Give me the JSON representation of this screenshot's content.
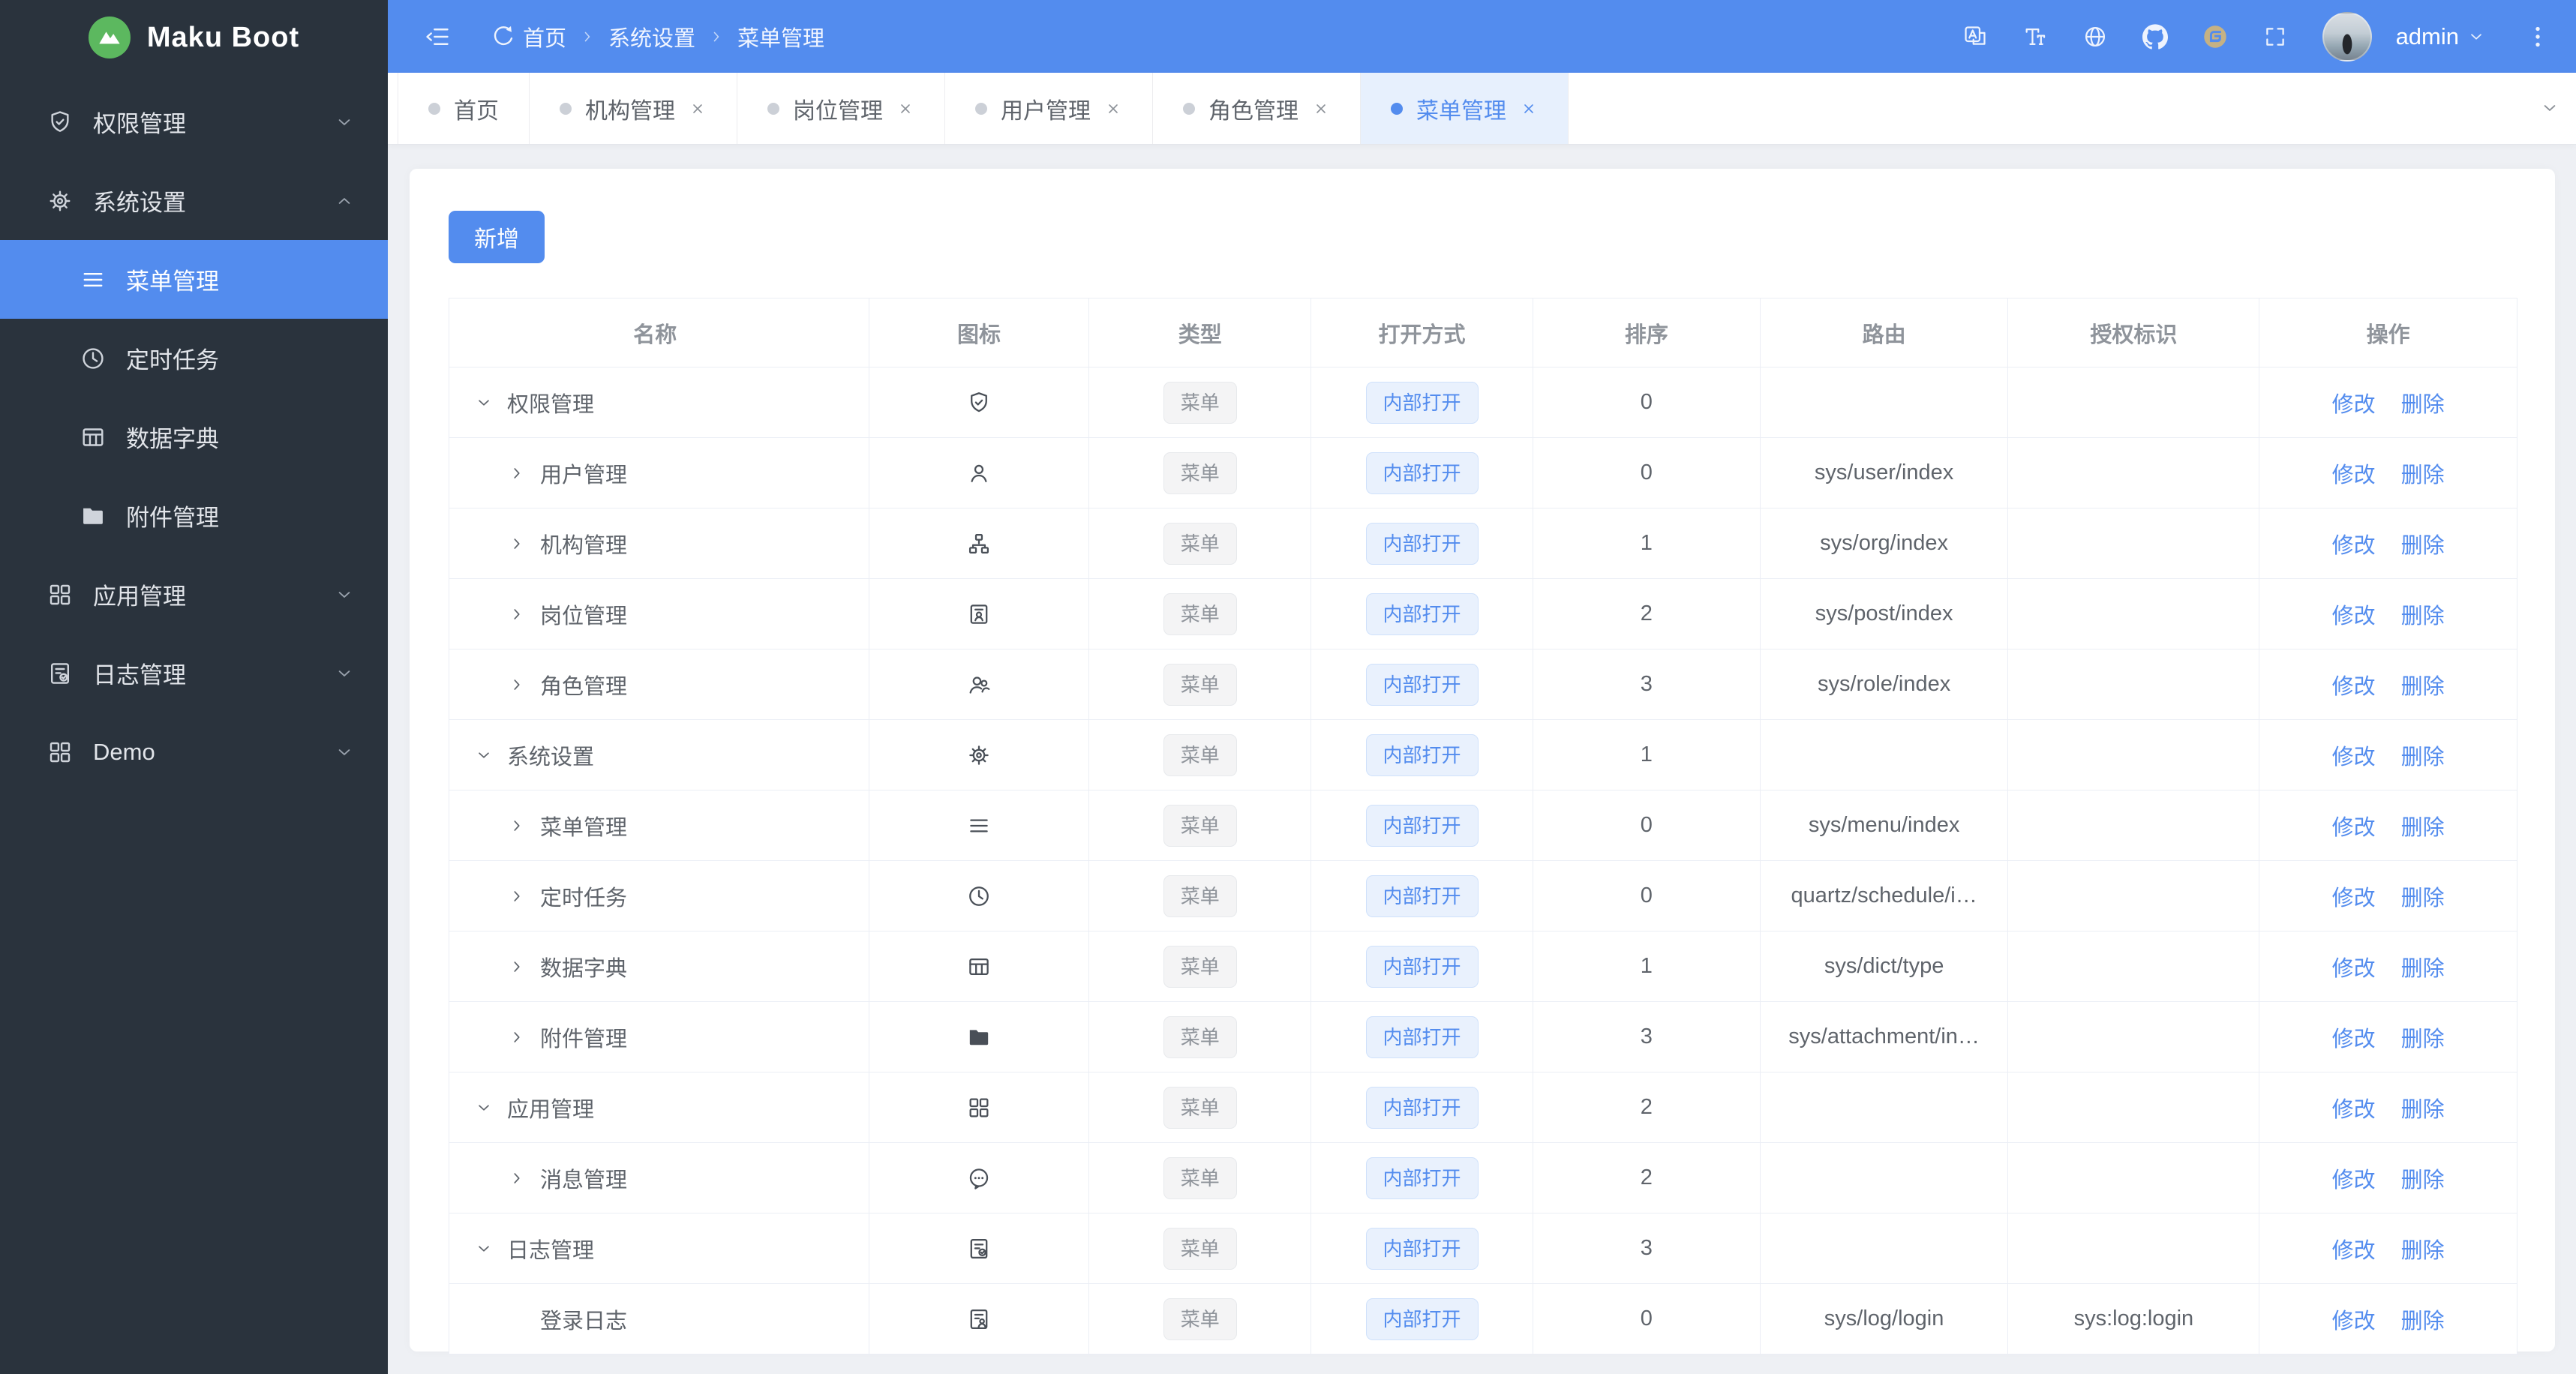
{
  "brand": {
    "name": "Maku Boot",
    "logo_icon": "mountain-logo-icon",
    "logo_color": "#5cb85f"
  },
  "colors": {
    "primary": "#538cee",
    "sidebar_bg": "#2a333d",
    "content_bg": "#eef0f4",
    "tag_gray_bg": "#f4f4f5",
    "tag_gray_text": "#8f949b",
    "tag_blue_bg": "#e9f1fd",
    "tag_blue_text": "#538cee",
    "gitee_gold": "#b9a77d",
    "table_border": "#ebeef5"
  },
  "sidebar": {
    "items": [
      {
        "label": "权限管理",
        "icon": "shield-icon",
        "caret": "down"
      },
      {
        "label": "系统设置",
        "icon": "gear-icon",
        "caret": "up",
        "children": [
          {
            "label": "菜单管理",
            "icon": "menu-icon",
            "active": true
          },
          {
            "label": "定时任务",
            "icon": "clock-icon"
          },
          {
            "label": "数据字典",
            "icon": "dict-icon"
          },
          {
            "label": "附件管理",
            "icon": "folder-icon"
          }
        ]
      },
      {
        "label": "应用管理",
        "icon": "apps-icon",
        "caret": "down"
      },
      {
        "label": "日志管理",
        "icon": "log-icon",
        "caret": "down"
      },
      {
        "label": "Demo",
        "icon": "apps-icon",
        "caret": "down"
      }
    ]
  },
  "topbar": {
    "left_icons": [
      "fold-icon",
      "refresh-icon"
    ],
    "breadcrumb": [
      "首页",
      "系统设置",
      "菜单管理"
    ],
    "right_icons": [
      "translate-icon",
      "font-size-icon",
      "globe-icon",
      "github-icon",
      "gitee-icon",
      "fullscreen-icon"
    ],
    "username": "admin",
    "more_icon": "more-icon"
  },
  "tabs": [
    {
      "label": "首页",
      "closable": false,
      "active": false
    },
    {
      "label": "机构管理",
      "closable": true,
      "active": false
    },
    {
      "label": "岗位管理",
      "closable": true,
      "active": false
    },
    {
      "label": "用户管理",
      "closable": true,
      "active": false
    },
    {
      "label": "角色管理",
      "closable": true,
      "active": false
    },
    {
      "label": "菜单管理",
      "closable": true,
      "active": true
    }
  ],
  "toolbar": {
    "add_label": "新增"
  },
  "table": {
    "columns": [
      "名称",
      "图标",
      "类型",
      "打开方式",
      "排序",
      "路由",
      "授权标识",
      "操作"
    ],
    "actions": [
      "修改",
      "删除"
    ],
    "rows": [
      {
        "name": "权限管理",
        "level": 0,
        "arrow": "down",
        "icon": "shield-icon",
        "type": "菜单",
        "open": "内部打开",
        "sort": "0",
        "route": "",
        "auth": ""
      },
      {
        "name": "用户管理",
        "level": 1,
        "arrow": "right",
        "icon": "user-icon",
        "type": "菜单",
        "open": "内部打开",
        "sort": "0",
        "route": "sys/user/index",
        "auth": ""
      },
      {
        "name": "机构管理",
        "level": 1,
        "arrow": "right",
        "icon": "org-icon",
        "type": "菜单",
        "open": "内部打开",
        "sort": "1",
        "route": "sys/org/index",
        "auth": ""
      },
      {
        "name": "岗位管理",
        "level": 1,
        "arrow": "right",
        "icon": "post-icon",
        "type": "菜单",
        "open": "内部打开",
        "sort": "2",
        "route": "sys/post/index",
        "auth": ""
      },
      {
        "name": "角色管理",
        "level": 1,
        "arrow": "right",
        "icon": "role-icon",
        "type": "菜单",
        "open": "内部打开",
        "sort": "3",
        "route": "sys/role/index",
        "auth": ""
      },
      {
        "name": "系统设置",
        "level": 0,
        "arrow": "down",
        "icon": "gear-icon",
        "type": "菜单",
        "open": "内部打开",
        "sort": "1",
        "route": "",
        "auth": ""
      },
      {
        "name": "菜单管理",
        "level": 1,
        "arrow": "right",
        "icon": "menu-icon",
        "type": "菜单",
        "open": "内部打开",
        "sort": "0",
        "route": "sys/menu/index",
        "auth": ""
      },
      {
        "name": "定时任务",
        "level": 1,
        "arrow": "right",
        "icon": "clock-icon",
        "type": "菜单",
        "open": "内部打开",
        "sort": "0",
        "route": "quartz/schedule/i…",
        "auth": ""
      },
      {
        "name": "数据字典",
        "level": 1,
        "arrow": "right",
        "icon": "dict-icon",
        "type": "菜单",
        "open": "内部打开",
        "sort": "1",
        "route": "sys/dict/type",
        "auth": ""
      },
      {
        "name": "附件管理",
        "level": 1,
        "arrow": "right",
        "icon": "folder-icon",
        "type": "菜单",
        "open": "内部打开",
        "sort": "3",
        "route": "sys/attachment/in…",
        "auth": ""
      },
      {
        "name": "应用管理",
        "level": 0,
        "arrow": "down",
        "icon": "apps-icon",
        "type": "菜单",
        "open": "内部打开",
        "sort": "2",
        "route": "",
        "auth": ""
      },
      {
        "name": "消息管理",
        "level": 1,
        "arrow": "right",
        "icon": "message-icon",
        "type": "菜单",
        "open": "内部打开",
        "sort": "2",
        "route": "",
        "auth": ""
      },
      {
        "name": "日志管理",
        "level": 0,
        "arrow": "down",
        "icon": "log-icon",
        "type": "菜单",
        "open": "内部打开",
        "sort": "3",
        "route": "",
        "auth": ""
      },
      {
        "name": "登录日志",
        "level": 1,
        "arrow": "none",
        "icon": "login-log-icon",
        "type": "菜单",
        "open": "内部打开",
        "sort": "0",
        "route": "sys/log/login",
        "auth": "sys:log:login"
      }
    ]
  }
}
